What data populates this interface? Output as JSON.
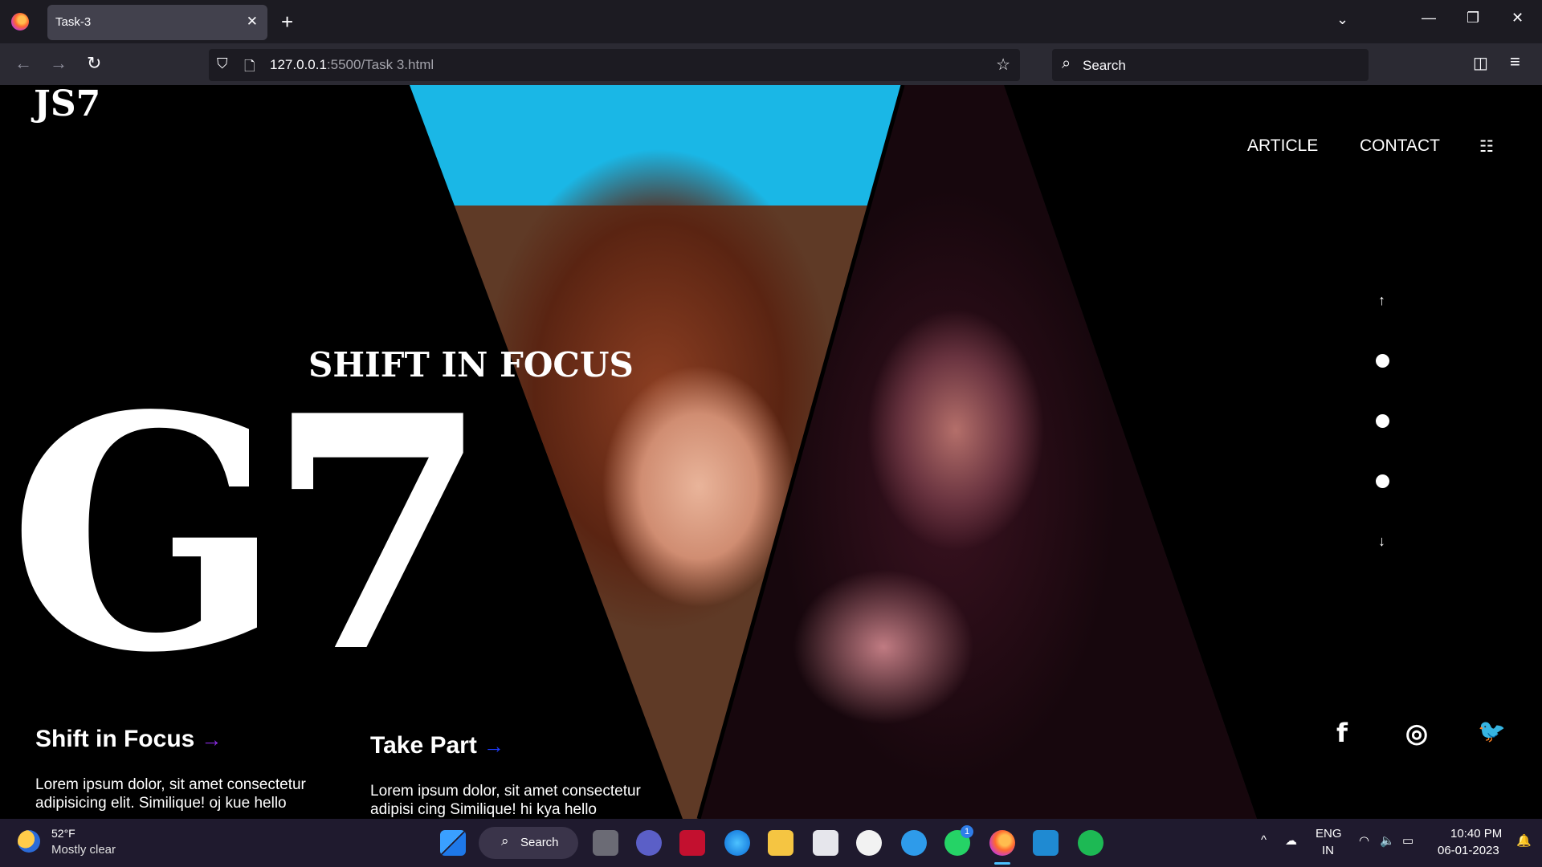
{
  "browser": {
    "tab_title": "Task-3",
    "tab_close": "✕",
    "new_tab": "+",
    "tab_list": "⌄",
    "minimize": "—",
    "restore": "❐",
    "close": "✕",
    "back": "←",
    "forward": "→",
    "reload": "↻",
    "url_host": "127.0.0.1",
    "url_rest": ":5500/Task 3.html",
    "bookmark_star": "☆",
    "search_placeholder": "Search",
    "pocket": "◫",
    "menu": "≡"
  },
  "site": {
    "brand": "JS7",
    "nav": [
      "ARTICLE",
      "CONTACT"
    ],
    "menu_icon": "☷",
    "hero_subtitle": "SHIFT IN FOCUS",
    "hero_title": "G7",
    "features": [
      {
        "title": "Shift in Focus",
        "arrow": "→",
        "arrow_color": "#8a2be2",
        "text": "Lorem ipsum dolor, sit amet consectetur adipisicing elit. Similique! oj kue hello"
      },
      {
        "title": "Take Part",
        "arrow": "→",
        "arrow_color": "#1e3cff",
        "text": "Lorem ipsum dolor, sit amet consectetur adipisi cing Similique! hi kya hello"
      }
    ],
    "pager": {
      "up": "↑",
      "down": "↓",
      "dots": 3
    },
    "social": {
      "facebook": "f",
      "instagram": "◎",
      "twitter": "🐦"
    }
  },
  "taskbar": {
    "temperature": "52°F",
    "weather": "Mostly clear",
    "search_label": "Search",
    "whatsapp_badge": "1",
    "lang_top": "ENG",
    "lang_bottom": "IN",
    "time": "10:40 PM",
    "date": "06-01-2023"
  }
}
